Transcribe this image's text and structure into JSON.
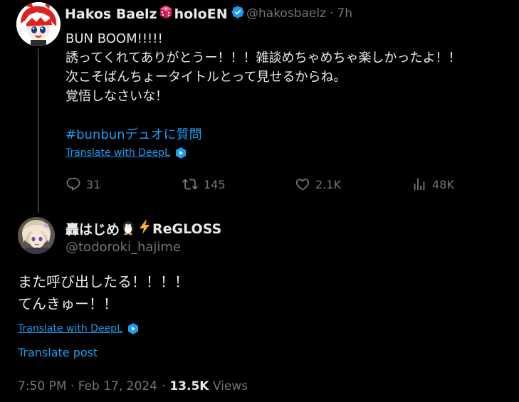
{
  "parent_tweet": {
    "author": {
      "name_part1": "Hakos Baelz",
      "name_part2": "holoEN",
      "name_emoji": "dice-icon",
      "verified": true,
      "handle": "@hakosbaelz",
      "time": "7h"
    },
    "text_lines": [
      "BUN BOOM!!!!!",
      "誘ってくれてありがとうー！！！雑談めちゃめちゃ楽しかったよ！！",
      "次こそばんちょータイトルとって見せるからね。",
      "覚悟しなさいな！"
    ],
    "hashtag": "#bunbunデュオに質問",
    "translate_label": "Translate with DeepL",
    "actions": {
      "replies": "31",
      "reposts": "145",
      "likes": "2.1K",
      "views": "48K"
    }
  },
  "main_tweet": {
    "author": {
      "name_part1": "轟はじめ",
      "name_part2": "ReGLOSS",
      "name_emojis": [
        "penguin-icon",
        "lightning-icon"
      ],
      "handle": "@todoroki_hajime"
    },
    "text_lines": [
      "また呼び出したる！！！！",
      "てんきゅー！！"
    ],
    "translate_label": "Translate with DeepL",
    "translate_post_label": "Translate post",
    "timestamp": "7:50 PM · Feb 17, 2024",
    "views_count": "13.5K",
    "views_label": "Views"
  },
  "colors": {
    "background": "#000000",
    "text_primary": "#e7e9ea",
    "text_secondary": "#71767b",
    "accent": "#1d9bf0",
    "thread_line": "#333639"
  }
}
